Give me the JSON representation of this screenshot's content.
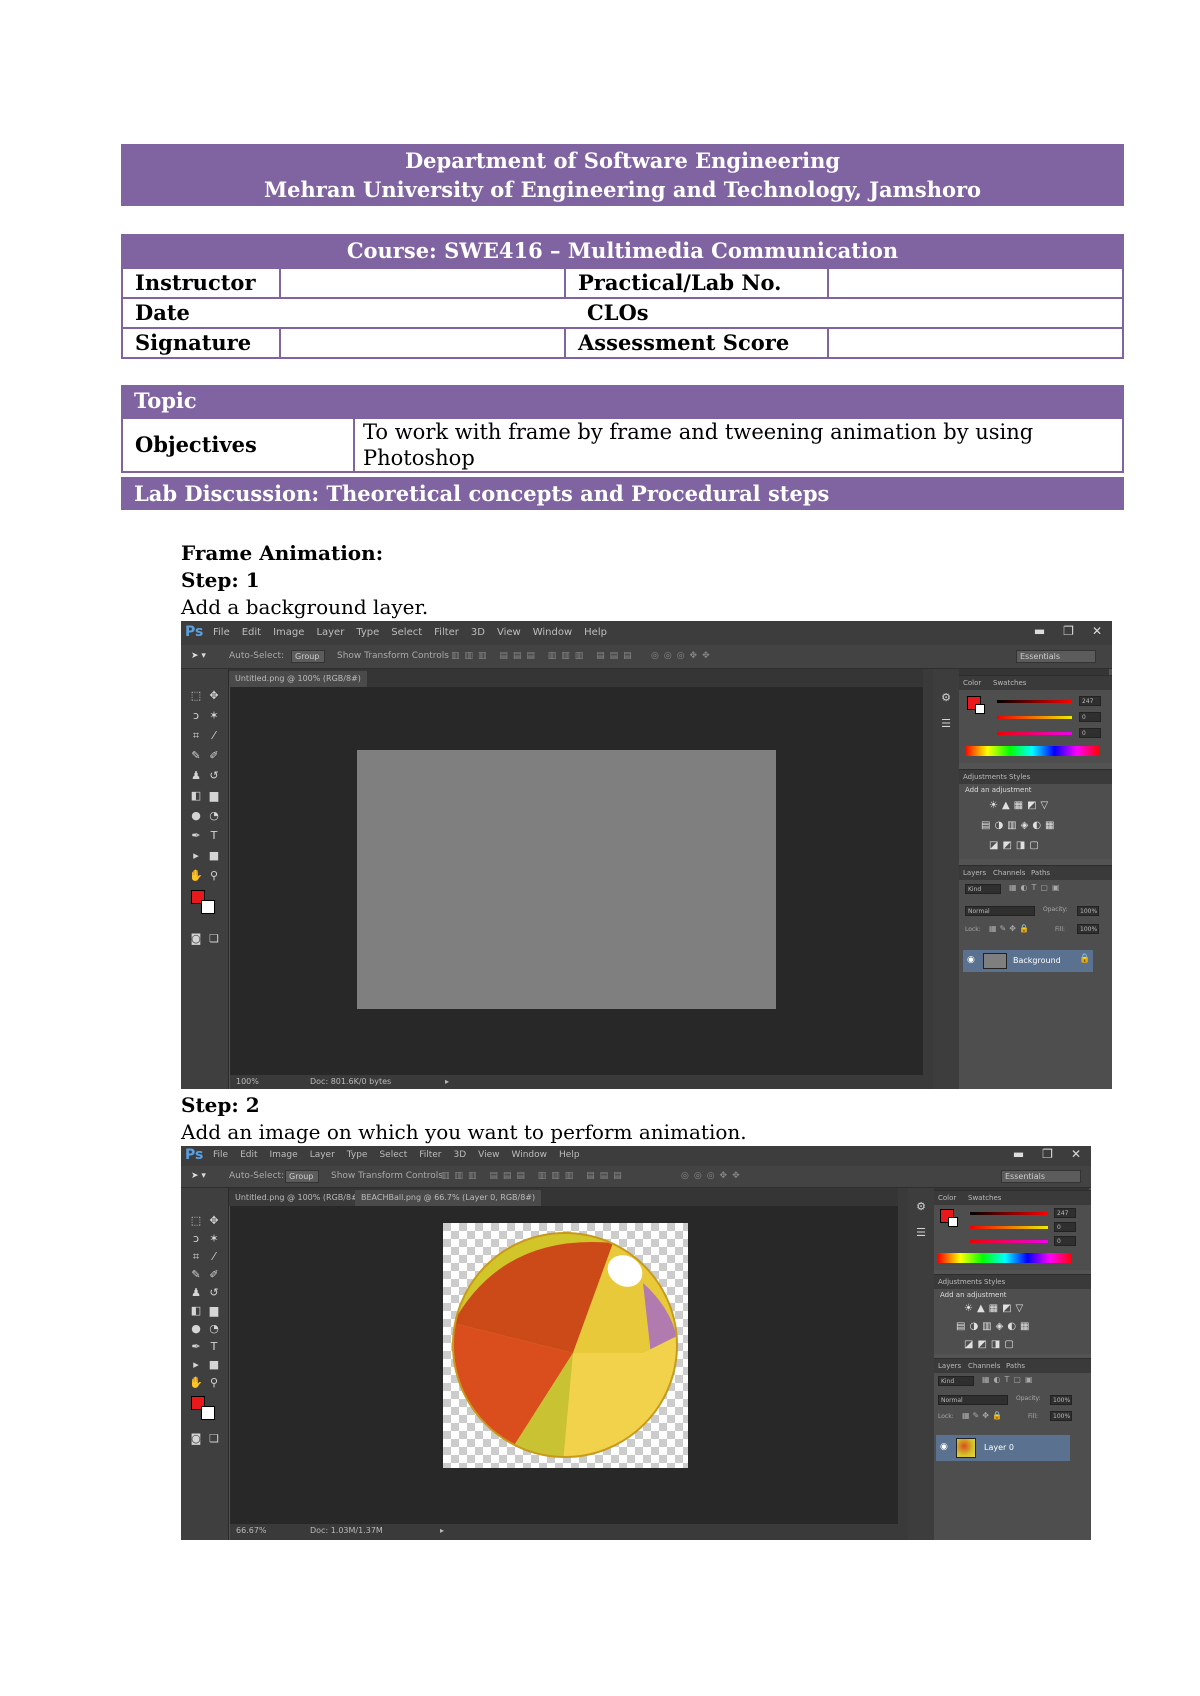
{
  "header": {
    "line1": "Department of Software Engineering",
    "line2": "Mehran University of Engineering and Technology, Jamshoro"
  },
  "course": "Course: SWE416 – Multimedia Communication",
  "info": {
    "instructor_label": "Instructor",
    "lab_label": "Practical/Lab No.",
    "date_label": "Date",
    "clos_label": "CLOs",
    "signature_label": "Signature",
    "score_label": "Assessment Score"
  },
  "topic": {
    "topic_label": "Topic",
    "objectives_label": "Objectives",
    "objectives_value": "To work with frame by frame and tweening animation by using Photoshop"
  },
  "discussion_title": "Lab Discussion: Theoretical concepts and Procedural steps",
  "section_title": "Frame Animation:",
  "step1": {
    "title": "Step: 1",
    "text": "Add a background layer."
  },
  "step2": {
    "title": "Step: 2",
    "text": "Add an image on which you want to perform animation."
  },
  "ps": {
    "logo": "Ps",
    "menus": [
      "File",
      "Edit",
      "Image",
      "Layer",
      "Type",
      "Select",
      "Filter",
      "3D",
      "View",
      "Window",
      "Help"
    ],
    "auto_select": "Auto-Select:",
    "group": "Group",
    "show_transform": "Show Transform Controls",
    "workspace": "Essentials",
    "panel_color": "Color",
    "panel_swatches": "Swatches",
    "panel_adjustments": "Adjustments",
    "panel_styles": "Styles",
    "add_adjustment": "Add an adjustment",
    "panel_layers": "Layers",
    "panel_channels": "Channels",
    "panel_paths": "Paths",
    "kind": "Kind",
    "normal": "Normal",
    "opacity": "Opacity:",
    "opacity_val": "100%",
    "lock": "Lock:",
    "fill": "Fill:",
    "r_val": "247",
    "g_val": "0",
    "b_val": "0",
    "win1": {
      "tab": "Untitled.png @ 100% (RGB/8#)",
      "zoom": "100%",
      "doc_info": "Doc: 801.6K/0 bytes",
      "layer_name": "Background"
    },
    "win2": {
      "tab1": "Untitled.png @ 100% (RGB/8#)",
      "tab2": "BEACHBall.png @ 66.7% (Layer 0, RGB/8#)",
      "zoom": "66.67%",
      "doc_info": "Doc: 1.03M/1.37M",
      "layer_name": "Layer 0"
    }
  },
  "colors": {
    "accent": "#8064a2",
    "fg_swatch": "#e8181b",
    "canvas_gray": "#7f7f7f"
  }
}
